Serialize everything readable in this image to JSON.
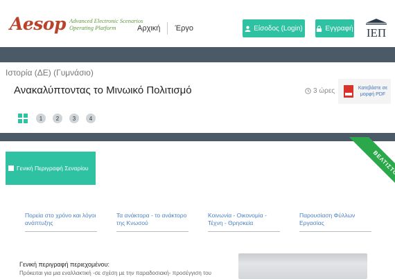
{
  "logo": {
    "word": "Aesop",
    "tagline_line1": "Advanced Electronic Scenarios",
    "tagline_line2": "Operating Platform"
  },
  "nav": {
    "items": [
      "Αρχική",
      "Έργο"
    ]
  },
  "header": {
    "login_label": "Είσοδος (Login)",
    "register_label": "Εγγραφή",
    "org_logo_text": "ΙΕΠ"
  },
  "scenario": {
    "subject": "Ιστορία (ΔΕ) (Γυμνάσιο)",
    "title": "Ανακαλύπτοντας το Μινωικό Πολιτισμό",
    "duration": "3 ώρες",
    "pdf_line1": "Κατεβάστε σε",
    "pdf_line2": "μορφή PDF",
    "steps": [
      "1",
      "2",
      "3",
      "4"
    ],
    "ribbon": "ΒΕΛΤΙΣΤΟ"
  },
  "overview": {
    "button_label": "Γενική Περιγραφή Σεναρίου"
  },
  "tabs": [
    {
      "label": "Πορεία στο χρόνο και λόγοι ανάπτυξης"
    },
    {
      "label": "Τα ανάκτορα - το ανάκτορο της Κνωσού"
    },
    {
      "label": "Κοινωνία - Οικονομία - Τέχνη - Θρησκεία"
    },
    {
      "label": "Παρουσίαση Φύλλων Εργασίας"
    }
  ],
  "description": {
    "heading": "Γενική περιγραφή περιεχομένου:",
    "text": "Πρόκειται για μια εναλλακτική -σε σχέση με την παραδοσιακή- προσέγγιση του"
  },
  "colors": {
    "accent": "#2ec1a2",
    "dark_bar": "#4b5a66",
    "ribbon": "#2aa84a",
    "logo": "#b8432a",
    "link": "#4a7fc0"
  }
}
